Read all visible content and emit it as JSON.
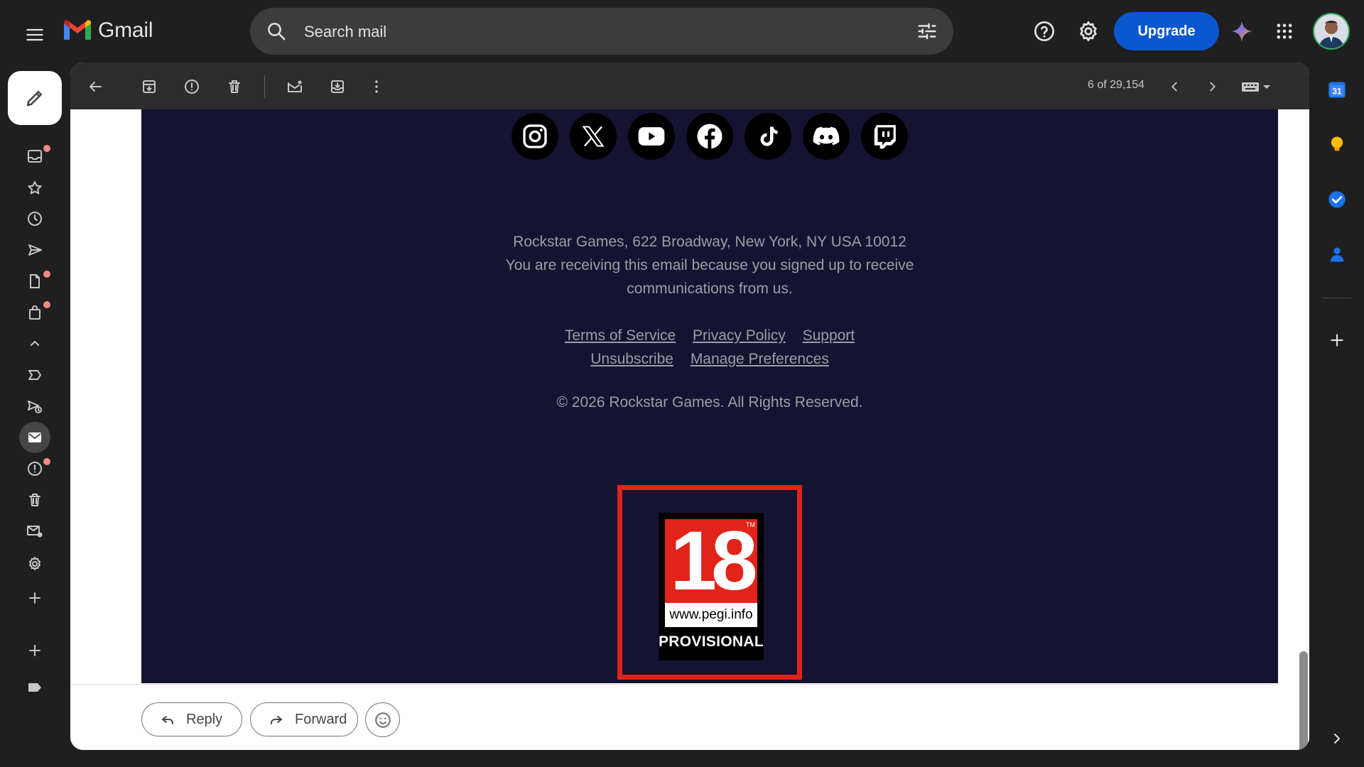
{
  "app": {
    "name": "Gmail"
  },
  "search": {
    "placeholder": "Search mail"
  },
  "header": {
    "upgrade_label": "Upgrade"
  },
  "toolbar": {
    "counter": "6 of 29,154"
  },
  "email": {
    "social": [
      "instagram-icon",
      "x-icon",
      "youtube-icon",
      "facebook-icon",
      "tiktok-icon",
      "discord-icon",
      "twitch-icon"
    ],
    "address": "Rockstar Games, 622 Broadway, New York, NY USA 10012",
    "notice_line1": "You are receiving this email because you signed up to receive",
    "notice_line2": "communications from us.",
    "links": {
      "terms": "Terms of Service",
      "privacy": "Privacy Policy",
      "support": "Support",
      "unsubscribe": "Unsubscribe",
      "preferences": "Manage Preferences"
    },
    "copyright": "© 2026 Rockstar Games. All Rights Reserved.",
    "rating": {
      "age": "18",
      "tm": "TM",
      "url": "www.pegi.info",
      "status": "PROVISIONAL"
    }
  },
  "actions": {
    "reply": "Reply",
    "forward": "Forward"
  },
  "calendar": {
    "day": "31"
  },
  "colors": {
    "accent": "#0b57d0",
    "dark_bg": "#1f1f1f",
    "email_bg": "#141432",
    "pegi_red": "#e2231a"
  }
}
